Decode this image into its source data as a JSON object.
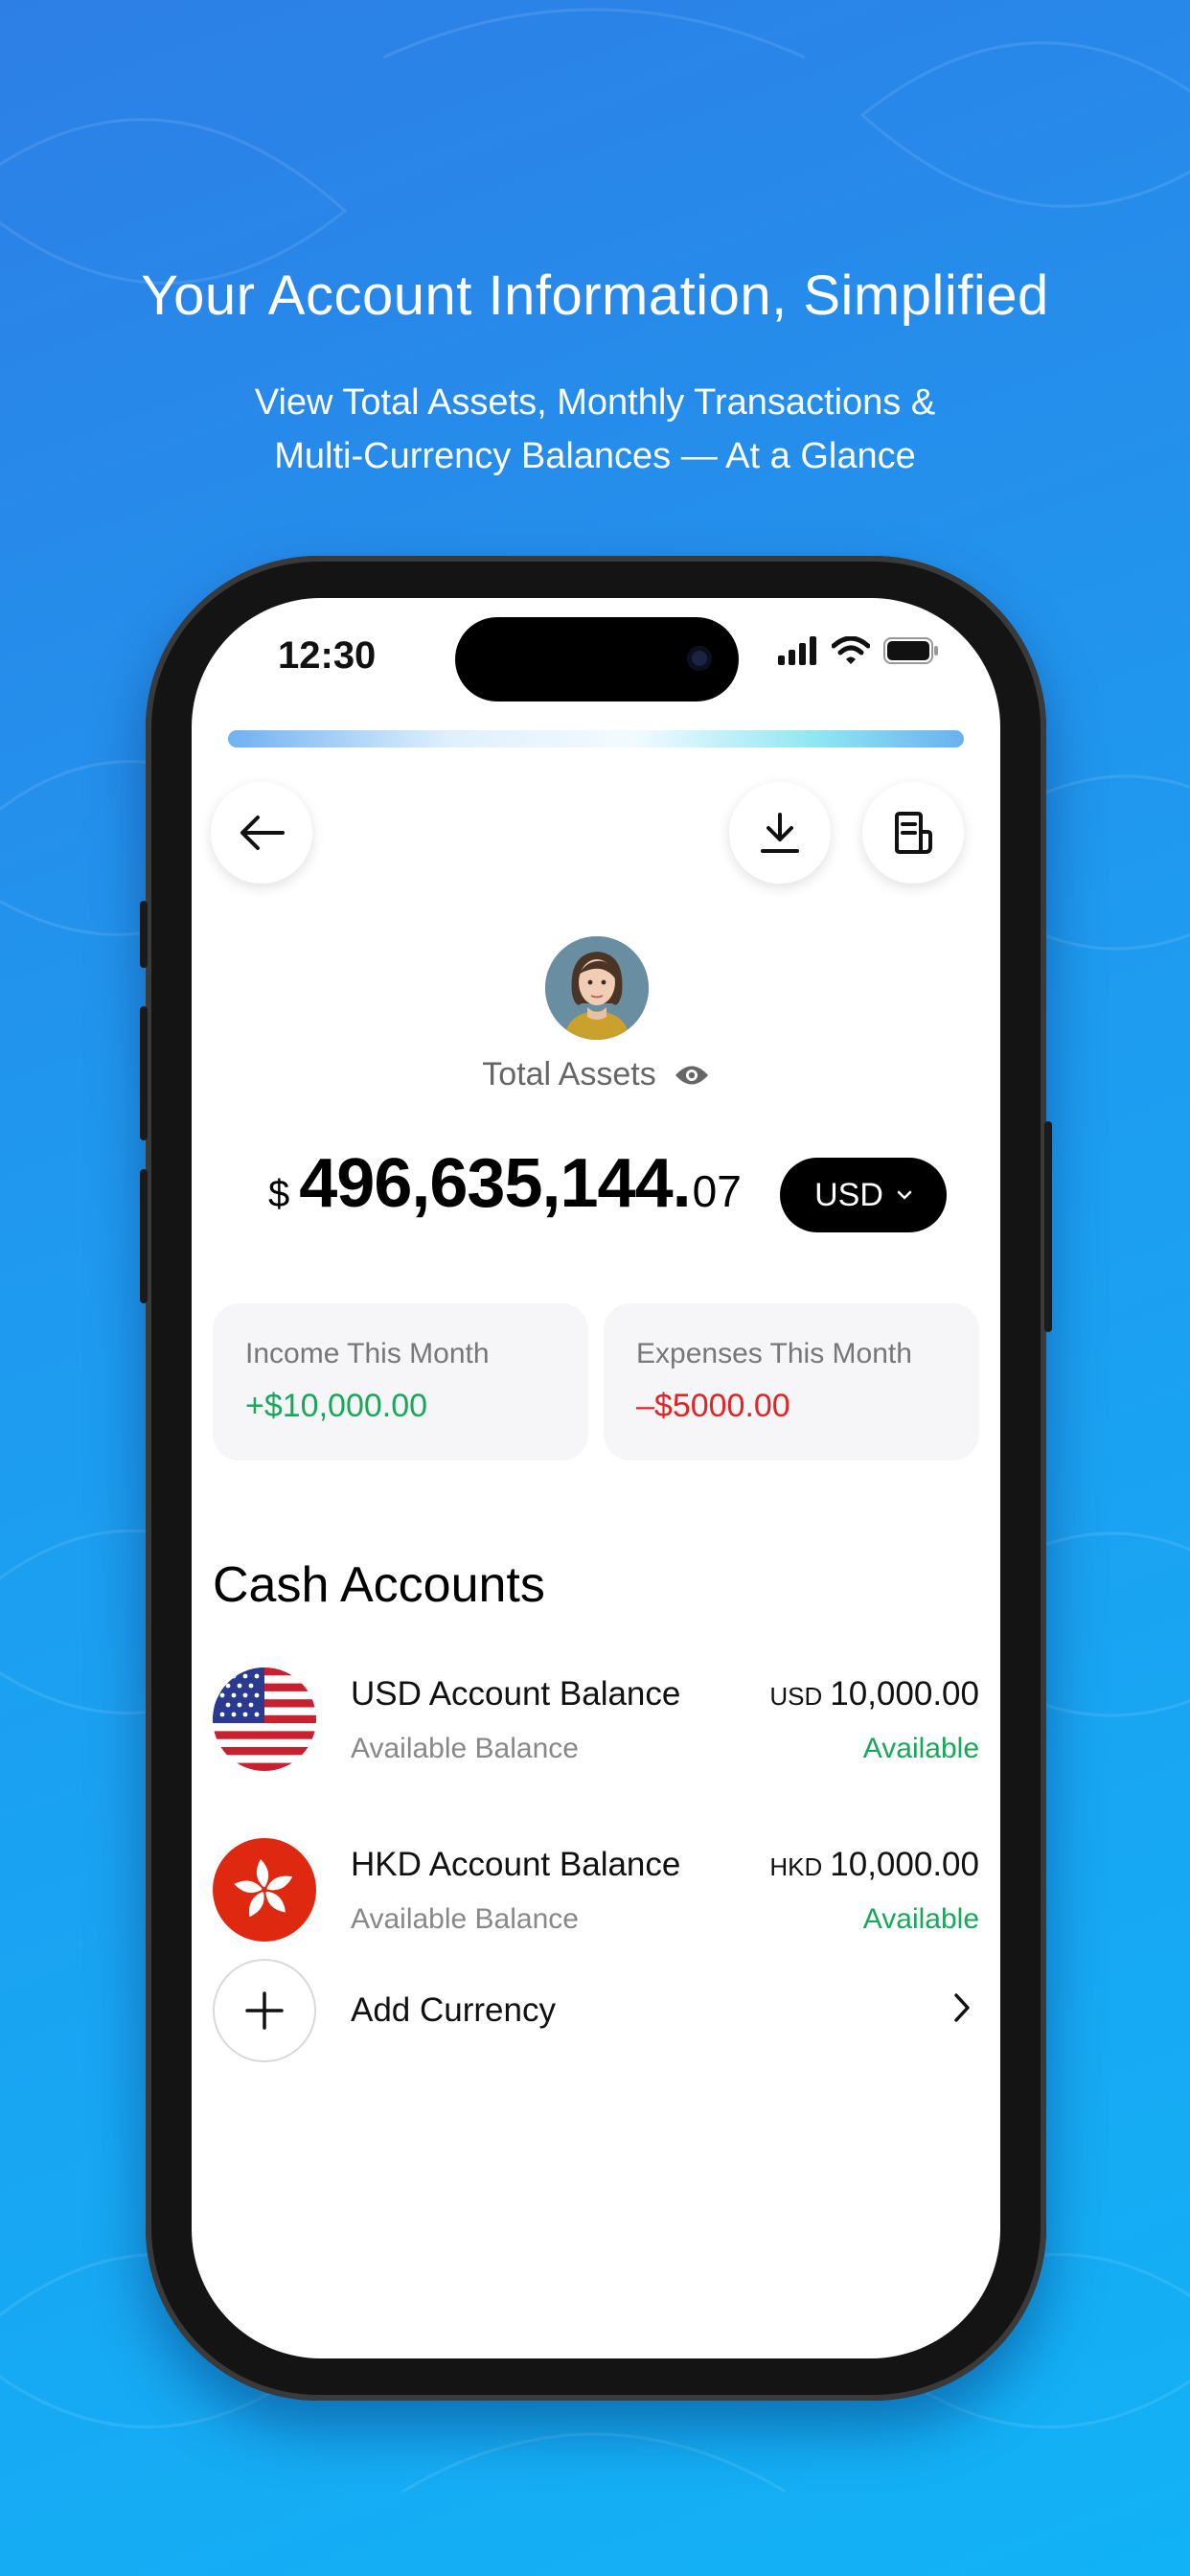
{
  "promo": {
    "headline": "Your Account Information, Simplified",
    "subline_1": "View Total Assets, Monthly Transactions &",
    "subline_2": "Multi-Currency Balances — At a Glance"
  },
  "status_bar": {
    "time": "12:30"
  },
  "progress": {
    "value": 1.0
  },
  "header": {
    "back_icon": "arrow-left-icon",
    "download_icon": "download-icon",
    "statement_icon": "statement-icon"
  },
  "assets": {
    "label": "Total Assets",
    "currency_symbol": "$",
    "amount_main": "496,635,144.",
    "amount_decimal": "07",
    "currency_selector": "USD"
  },
  "monthly": {
    "income_label": "Income This Month",
    "income_value": "+$10,000.00",
    "expenses_label": "Expenses This Month",
    "expenses_value": "–$5000.00"
  },
  "cash_accounts": {
    "title": "Cash Accounts",
    "items": [
      {
        "flag": "us-flag",
        "title": "USD Account Balance",
        "subtitle": "Available Balance",
        "currency": "USD",
        "amount": "10,000.00",
        "status": "Available"
      },
      {
        "flag": "hk-flag",
        "title": "HKD Account Balance",
        "subtitle": "Available Balance",
        "currency": "HKD",
        "amount": "10,000.00",
        "status": "Available"
      }
    ],
    "add_label": "Add Currency"
  },
  "colors": {
    "income": "#18a85a",
    "expense": "#e12424",
    "background_start": "#2d7fe6",
    "background_end": "#12b2f6"
  }
}
